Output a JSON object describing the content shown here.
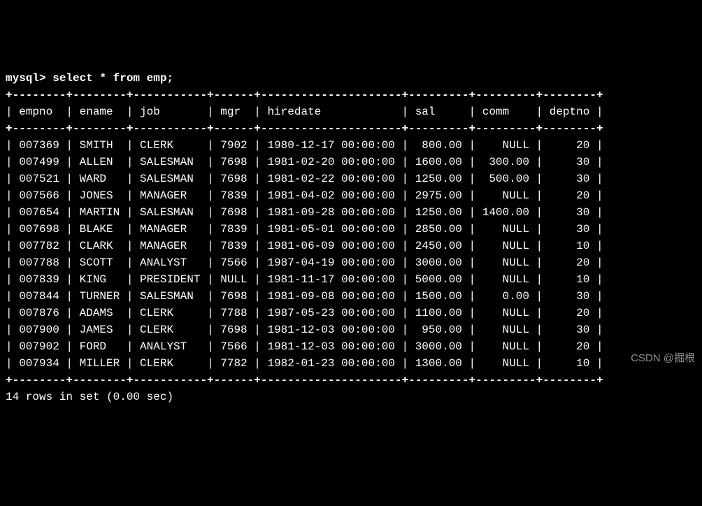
{
  "prompt": "mysql> select * from emp;",
  "border": "+--------+--------+-----------+------+---------------------+---------+---------+--------+",
  "columns": [
    "empno",
    "ename",
    "job",
    "mgr",
    "hiredate",
    "sal",
    "comm",
    "deptno"
  ],
  "rows": [
    {
      "empno": "007369",
      "ename": "SMITH",
      "job": "CLERK",
      "mgr": "7902",
      "hiredate": "1980-12-17 00:00:00",
      "sal": "800.00",
      "comm": "NULL",
      "deptno": "20"
    },
    {
      "empno": "007499",
      "ename": "ALLEN",
      "job": "SALESMAN",
      "mgr": "7698",
      "hiredate": "1981-02-20 00:00:00",
      "sal": "1600.00",
      "comm": "300.00",
      "deptno": "30"
    },
    {
      "empno": "007521",
      "ename": "WARD",
      "job": "SALESMAN",
      "mgr": "7698",
      "hiredate": "1981-02-22 00:00:00",
      "sal": "1250.00",
      "comm": "500.00",
      "deptno": "30"
    },
    {
      "empno": "007566",
      "ename": "JONES",
      "job": "MANAGER",
      "mgr": "7839",
      "hiredate": "1981-04-02 00:00:00",
      "sal": "2975.00",
      "comm": "NULL",
      "deptno": "20"
    },
    {
      "empno": "007654",
      "ename": "MARTIN",
      "job": "SALESMAN",
      "mgr": "7698",
      "hiredate": "1981-09-28 00:00:00",
      "sal": "1250.00",
      "comm": "1400.00",
      "deptno": "30"
    },
    {
      "empno": "007698",
      "ename": "BLAKE",
      "job": "MANAGER",
      "mgr": "7839",
      "hiredate": "1981-05-01 00:00:00",
      "sal": "2850.00",
      "comm": "NULL",
      "deptno": "30"
    },
    {
      "empno": "007782",
      "ename": "CLARK",
      "job": "MANAGER",
      "mgr": "7839",
      "hiredate": "1981-06-09 00:00:00",
      "sal": "2450.00",
      "comm": "NULL",
      "deptno": "10"
    },
    {
      "empno": "007788",
      "ename": "SCOTT",
      "job": "ANALYST",
      "mgr": "7566",
      "hiredate": "1987-04-19 00:00:00",
      "sal": "3000.00",
      "comm": "NULL",
      "deptno": "20"
    },
    {
      "empno": "007839",
      "ename": "KING",
      "job": "PRESIDENT",
      "mgr": "NULL",
      "hiredate": "1981-11-17 00:00:00",
      "sal": "5000.00",
      "comm": "NULL",
      "deptno": "10"
    },
    {
      "empno": "007844",
      "ename": "TURNER",
      "job": "SALESMAN",
      "mgr": "7698",
      "hiredate": "1981-09-08 00:00:00",
      "sal": "1500.00",
      "comm": "0.00",
      "deptno": "30"
    },
    {
      "empno": "007876",
      "ename": "ADAMS",
      "job": "CLERK",
      "mgr": "7788",
      "hiredate": "1987-05-23 00:00:00",
      "sal": "1100.00",
      "comm": "NULL",
      "deptno": "20"
    },
    {
      "empno": "007900",
      "ename": "JAMES",
      "job": "CLERK",
      "mgr": "7698",
      "hiredate": "1981-12-03 00:00:00",
      "sal": "950.00",
      "comm": "NULL",
      "deptno": "30"
    },
    {
      "empno": "007902",
      "ename": "FORD",
      "job": "ANALYST",
      "mgr": "7566",
      "hiredate": "1981-12-03 00:00:00",
      "sal": "3000.00",
      "comm": "NULL",
      "deptno": "20"
    },
    {
      "empno": "007934",
      "ename": "MILLER",
      "job": "CLERK",
      "mgr": "7782",
      "hiredate": "1982-01-23 00:00:00",
      "sal": "1300.00",
      "comm": "NULL",
      "deptno": "10"
    }
  ],
  "footer": "14 rows in set (0.00 sec)",
  "watermark": "CSDN @掘根",
  "widths": {
    "empno": 6,
    "ename": 6,
    "job": 9,
    "mgr": 4,
    "hiredate": 19,
    "sal": 7,
    "comm": 7,
    "deptno": 6
  }
}
